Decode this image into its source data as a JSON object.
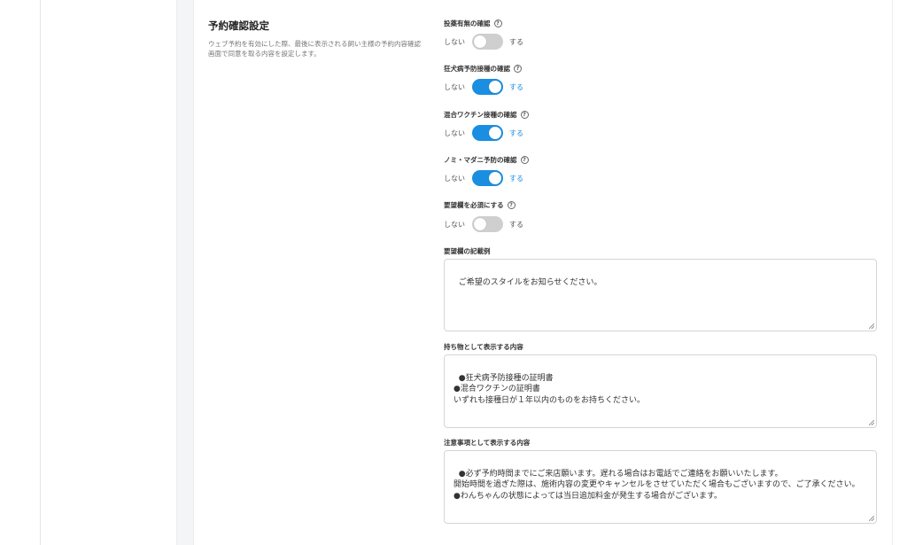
{
  "section": {
    "title": "予約確認設定",
    "description": "ウェブ予約を有効にした際、最後に表示される飼い主様の予約内容確認画面で同意を取る内容を設定します。"
  },
  "toggles": [
    {
      "label": "投薬有無の確認",
      "off_label": "しない",
      "on_label": "する",
      "state": "off"
    },
    {
      "label": "狂犬病予防接種の確認",
      "off_label": "しない",
      "on_label": "する",
      "state": "on"
    },
    {
      "label": "混合ワクチン接種の確認",
      "off_label": "しない",
      "on_label": "する",
      "state": "on"
    },
    {
      "label": "ノミ・マダニ予防の確認",
      "off_label": "しない",
      "on_label": "する",
      "state": "on"
    },
    {
      "label": "要望欄を必須にする",
      "off_label": "しない",
      "on_label": "する",
      "state": "off"
    }
  ],
  "textareas": [
    {
      "label": "要望欄の記載例",
      "value": "ご希望のスタイルをお知らせください。"
    },
    {
      "label": "持ち物として表示する内容",
      "value": "●狂犬病予防接種の証明書\n●混合ワクチンの証明書\nいずれも接種日が１年以内のものをお持ちください。"
    },
    {
      "label": "注意事項として表示する内容",
      "value": "●必ず予約時間までにご来店願います。遅れる場合はお電話でご連絡をお願いいたします。\n開始時間を過ぎた際は、施術内容の変更やキャンセルをさせていただく場合もございますので、ご了承ください。\n●わんちゃんの状態によっては当日追加料金が発生する場合がございます。"
    }
  ],
  "help_icon_glyph": "?",
  "colors": {
    "accent": "#1a8ee0",
    "toggle_off": "#cfcfcf"
  }
}
